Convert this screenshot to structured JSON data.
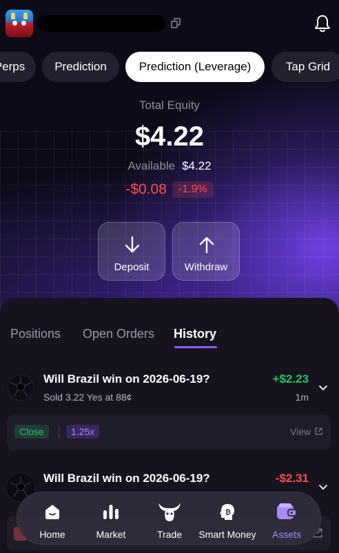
{
  "header": {
    "copy_icon": "copy-icon",
    "bell_icon": "bell-icon"
  },
  "tabs": [
    {
      "label": "Perps"
    },
    {
      "label": "Prediction"
    },
    {
      "label": "Prediction (Leverage)",
      "active": true
    },
    {
      "label": "Tap Grid"
    }
  ],
  "equity": {
    "label": "Total Equity",
    "value": "$4.22",
    "available_label": "Available",
    "available_value": "$4.22",
    "pnl_value": "-$0.08",
    "pnl_percent": "-1.9%"
  },
  "actions": {
    "deposit": "Deposit",
    "withdraw": "Withdraw"
  },
  "subtabs": [
    {
      "label": "Positions"
    },
    {
      "label": "Open Orders"
    },
    {
      "label": "History",
      "active": true
    }
  ],
  "history": [
    {
      "title": "Will Brazil win on 2026-06-19?",
      "subtitle": "Sold 3.22 Yes at 88¢",
      "amount": "+$2.23",
      "time": "1m",
      "close_tag": "Close",
      "leverage": "1.25x",
      "view_label": "View"
    },
    {
      "title": "Will Brazil win on 2026-06-19?",
      "amount": "-$2.31"
    }
  ],
  "nav": [
    {
      "label": "Home",
      "icon": "home-icon"
    },
    {
      "label": "Market",
      "icon": "market-icon"
    },
    {
      "label": "Trade",
      "icon": "trade-icon"
    },
    {
      "label": "Smart Money",
      "icon": "smart-money-icon"
    },
    {
      "label": "Assets",
      "icon": "assets-icon",
      "active": true
    }
  ],
  "colors": {
    "positive": "#22c55e",
    "negative": "#ff4d4f",
    "accent": "#8b5cf6"
  }
}
